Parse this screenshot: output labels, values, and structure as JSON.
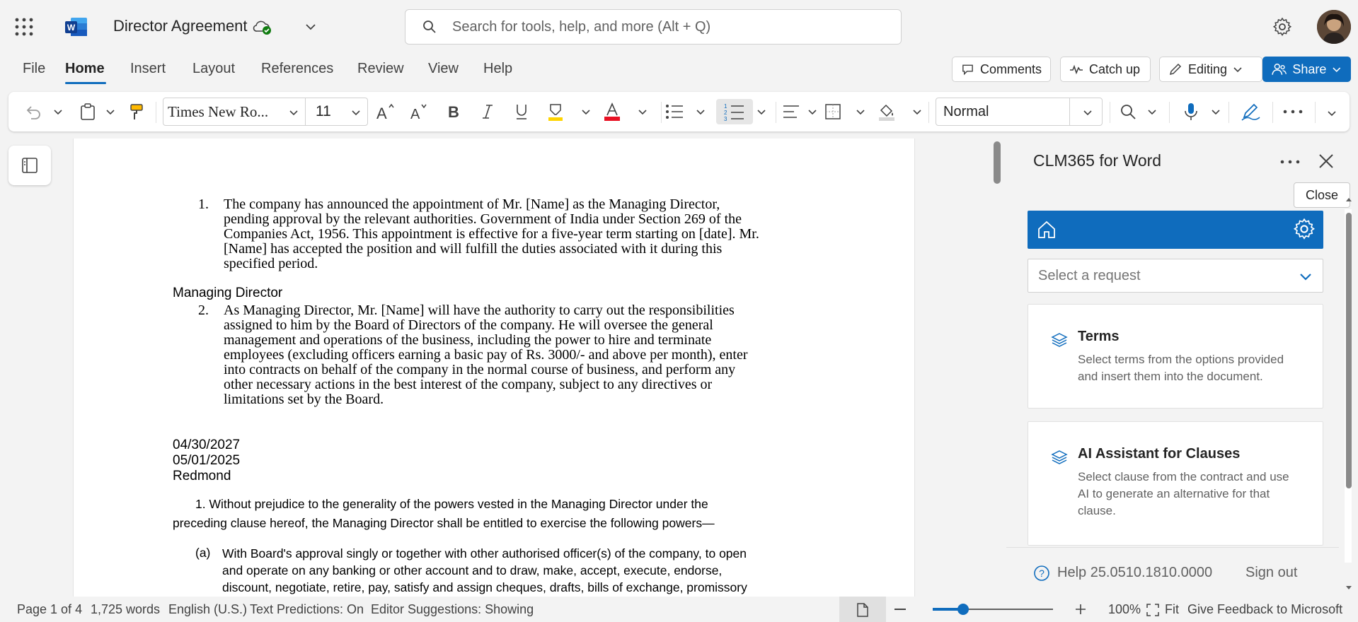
{
  "app": {
    "doc_title": "Director Agreement",
    "search_placeholder": "Search for tools, help, and more (Alt + Q)"
  },
  "menu": {
    "items": [
      "File",
      "Home",
      "Insert",
      "Layout",
      "References",
      "Review",
      "View",
      "Help"
    ],
    "active": "Home",
    "comments": "Comments",
    "catch_up": "Catch up",
    "editing": "Editing",
    "share": "Share"
  },
  "ribbon": {
    "font_name": "Times New Ro...",
    "font_size": "11",
    "style": "Normal",
    "font_color": "#e81123"
  },
  "document": {
    "item1_num": "1.",
    "item1_lines": [
      "The company has announced the appointment of Mr. [Name] as the Managing Director,",
      "pending approval by the relevant authorities. Government of India under Section 269 of the",
      "Companies Act, 1956. This appointment is effective for a five-year term starting on [date]. Mr.",
      "[Name] has accepted the position and will fulfill the duties associated with it during this",
      "specified period."
    ],
    "heading": "Managing Director",
    "item2_num": "2.",
    "item2_lines": [
      "As Managing Director, Mr. [Name] will have the authority to carry out the responsibilities",
      "assigned to him by the Board of Directors of the company. He will oversee the general",
      "management and operations of the business, including the power to hire and terminate",
      "employees (excluding officers earning a basic pay of Rs. 3000/- and above per month), enter",
      "into contracts on behalf of the company in the normal course of business, and perform any",
      "other necessary actions in the best interest of the company, subject to any directives or",
      "limitations set by the Board."
    ],
    "date1": "04/30/2027",
    "date2": "05/01/2025",
    "place": "Redmond",
    "clause_line1": "1.  Without prejudice to the generality of the powers vested in the Managing Director under the",
    "clause_line2": "preceding clause hereof, the Managing Director shall be entitled to exercise the following powers—",
    "sub_label": "(a)",
    "sub_lines": [
      "With Board's approval singly or together with other authorised officer(s) of the company, to open",
      "and operate on any banking or other account and to draw, make, accept, execute, endorse,",
      "discount, negotiate, retire, pay, satisfy and assign cheques, drafts, bills of exchange, promissory"
    ]
  },
  "pane": {
    "title": "CLM365 for Word",
    "tooltip": "Close",
    "select_placeholder": "Select a request",
    "cards": [
      {
        "title": "Terms",
        "desc": [
          "Select terms from the options provided",
          "and insert them into the document."
        ]
      },
      {
        "title": "AI Assistant for Clauses",
        "desc": [
          "Select clause from the contract and use",
          "AI to generate an alternative for that",
          "clause."
        ]
      }
    ],
    "help": "Help 25.0510.1810.0000",
    "sign_out": "Sign out",
    "accent": "#0f6cbd"
  },
  "status": {
    "page": "Page 1 of 4",
    "words": "1,725 words",
    "language": "English (U.S.)",
    "predictions": "Text Predictions: On",
    "editor": "Editor Suggestions: Showing",
    "zoom": "100%",
    "fit": "Fit",
    "feedback": "Give Feedback to Microsoft",
    "zoom_level": 0.25
  }
}
